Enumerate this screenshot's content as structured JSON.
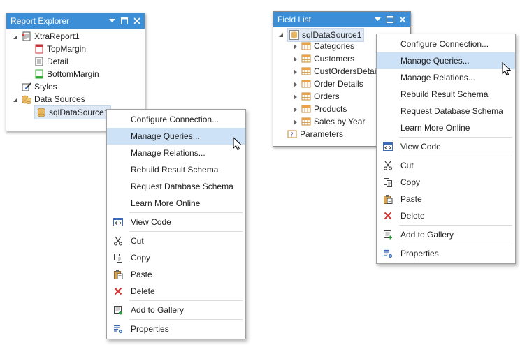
{
  "report_explorer": {
    "title": "Report Explorer",
    "tree": {
      "root": "XtraReport1",
      "bands": [
        "TopMargin",
        "Detail",
        "BottomMargin"
      ],
      "styles": "Styles",
      "data_sources": "Data Sources",
      "data_source_item": "sqlDataSource1"
    }
  },
  "field_list": {
    "title": "Field List",
    "tree": {
      "root": "sqlDataSource1",
      "tables": [
        "Categories",
        "Customers",
        "CustOrdersDetail",
        "Order Details",
        "Orders",
        "Products",
        "Sales by Year"
      ],
      "parameters": "Parameters"
    }
  },
  "context_menu": {
    "items": [
      {
        "label": "Configure Connection...",
        "icon": "none",
        "highlighted": false
      },
      {
        "label": "Manage Queries...",
        "icon": "none",
        "highlighted": true
      },
      {
        "label": "Manage Relations...",
        "icon": "none",
        "highlighted": false
      },
      {
        "label": "Rebuild Result Schema",
        "icon": "none",
        "highlighted": false
      },
      {
        "label": "Request Database Schema",
        "icon": "none",
        "highlighted": false
      },
      {
        "label": "Learn More Online",
        "icon": "none",
        "highlighted": false
      },
      {
        "label": "View Code",
        "icon": "view-code-icon",
        "highlighted": false
      },
      {
        "label": "Cut",
        "icon": "scissors-icon",
        "highlighted": false
      },
      {
        "label": "Copy",
        "icon": "copy-icon",
        "highlighted": false
      },
      {
        "label": "Paste",
        "icon": "paste-icon",
        "highlighted": false
      },
      {
        "label": "Delete",
        "icon": "delete-x-icon",
        "highlighted": false
      },
      {
        "label": "Add to Gallery",
        "icon": "add-to-gallery-icon",
        "highlighted": false
      },
      {
        "label": "Properties",
        "icon": "properties-icon",
        "highlighted": false
      }
    ]
  },
  "colors": {
    "header_blue": "#3c8fd6",
    "menu_highlight": "#cde1f7",
    "delete_red": "#d32f2f",
    "add_green": "#2e9b3a",
    "table_orange": "#e8a24a"
  }
}
